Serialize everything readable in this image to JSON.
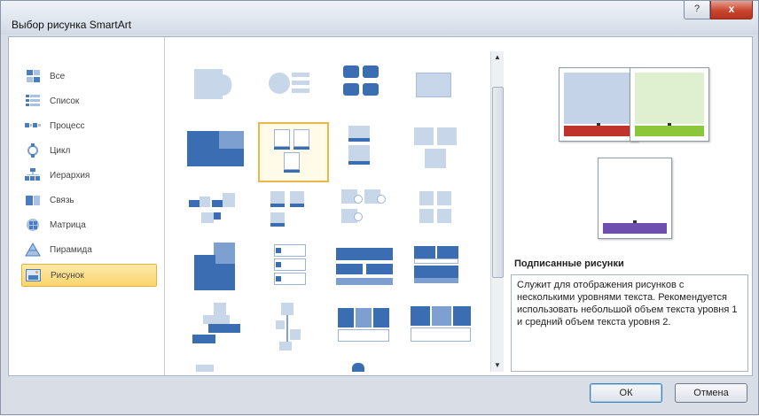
{
  "window": {
    "title": "Выбор рисунка SmartArt",
    "help_label": "?",
    "close_label": "x"
  },
  "categories": [
    {
      "label": "Все",
      "icon": "all-icon"
    },
    {
      "label": "Список",
      "icon": "list-icon"
    },
    {
      "label": "Процесс",
      "icon": "process-icon"
    },
    {
      "label": "Цикл",
      "icon": "cycle-icon"
    },
    {
      "label": "Иерархия",
      "icon": "hierarchy-icon"
    },
    {
      "label": "Связь",
      "icon": "relationship-icon"
    },
    {
      "label": "Матрица",
      "icon": "matrix-icon"
    },
    {
      "label": "Пирамида",
      "icon": "pyramid-icon"
    },
    {
      "label": "Рисунок",
      "icon": "picture-icon",
      "selected": true
    }
  ],
  "gallery": {
    "selected_index": 5,
    "scroll_up": "▲",
    "scroll_down": "▼"
  },
  "details": {
    "title": "Подписанные рисунки",
    "description": "Служит для отображения рисунков с несколькими уровнями текста. Рекомендуется использовать небольшой объем текста уровня 1 и средний объем текста уровня 2."
  },
  "colors": {
    "band_red": "#c0322c",
    "band_green": "#8cc63a",
    "band_purple": "#6d4fb0",
    "selection": "#fbd56e"
  },
  "buttons": {
    "ok_label": "ОК",
    "cancel_label": "Отмена"
  }
}
